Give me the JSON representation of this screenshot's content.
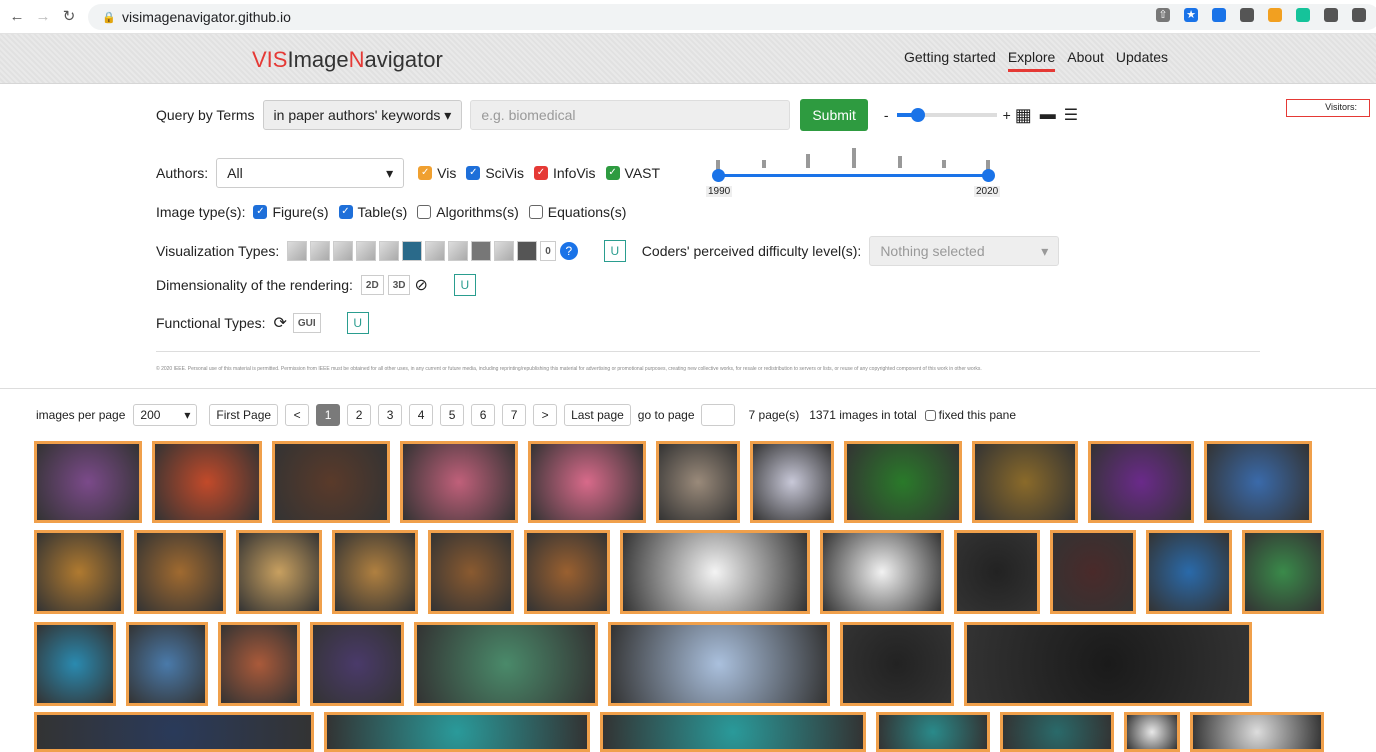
{
  "browser": {
    "url": "visimagenavigator.github.io"
  },
  "brand": {
    "p1": "VIS",
    "p2": "Image",
    "p3": "N",
    "p4": "avigator"
  },
  "nav": [
    "Getting started",
    "Explore",
    "About",
    "Updates"
  ],
  "query": {
    "label": "Query by Terms",
    "scope": "in paper authors' keywords",
    "placeholder": "e.g. biomedical",
    "submit": "Submit",
    "zoom_minus": "-",
    "zoom_plus": "+"
  },
  "visitors": "Visitors:",
  "authors": {
    "label": "Authors:",
    "value": "All"
  },
  "venues": [
    {
      "label": "Vis",
      "color": "#f0a030"
    },
    {
      "label": "SciVis",
      "color": "#1e6fd9"
    },
    {
      "label": "InfoVis",
      "color": "#e53935"
    },
    {
      "label": "VAST",
      "color": "#2e9b40"
    }
  ],
  "years": {
    "start": "1990",
    "end": "2020"
  },
  "image_types": {
    "label": "Image type(s):",
    "items": [
      {
        "label": "Figure(s)",
        "checked": true
      },
      {
        "label": "Table(s)",
        "checked": true
      },
      {
        "label": "Algorithms(s)",
        "checked": false
      },
      {
        "label": "Equations(s)",
        "checked": false
      }
    ]
  },
  "vis_types": {
    "label": "Visualization Types:",
    "zero": "0",
    "help": "?"
  },
  "u_label": "U",
  "difficulty": {
    "label": "Coders' perceived difficulty level(s):",
    "value": "Nothing selected"
  },
  "dimensionality": {
    "label": "Dimensionality of the rendering:",
    "d2": "2D",
    "d3": "3D"
  },
  "functional": {
    "label": "Functional Types:",
    "gui": "GUI"
  },
  "copyright": "© 2020 IEEE. Personal use of this material is permitted. Permission from IEEE must be obtained for all other uses, in any current or future media, including reprinting/republishing this material for advertising or promotional purposes, creating new collective works, for resale or redistribution to servers or lists, or reuse of any copyrighted component of this work in other works.",
  "pagination": {
    "per_page_label": "images per page",
    "per_page": "200",
    "first": "First Page",
    "prev": "<",
    "pages": [
      "1",
      "2",
      "3",
      "4",
      "5",
      "6",
      "7"
    ],
    "next": ">",
    "last": "Last page",
    "goto": "go to page",
    "summary": "7 page(s)   1371 images in total",
    "fixed": "fixed this pane"
  },
  "thumb_colors": [
    "#7b4a8a",
    "#c24a2a",
    "#5a3a2a",
    "#c0607a",
    "#d86a8a",
    "#9a8a7a",
    "#c8c8d8",
    "#2a7a2a",
    "#8a6a2a",
    "#6a2a8a",
    "#3a6aaa",
    "#b07a30",
    "#a06a30",
    "#c8a060",
    "#b08040",
    "#8a5a30",
    "#9a6030",
    "#f4f4f4",
    "#f2f2f2",
    "#222",
    "#4a2a2a",
    "#2a6aaa",
    "#3a8a4a",
    "#2a8ab0",
    "#4a7aaa",
    "#aa5a3a",
    "#4a3a6a",
    "#4a8a6a",
    "#aac0dd",
    "#222",
    "#1a1a1a",
    "#2a3a5a",
    "#2a9a9a",
    "#2a9a9a",
    "#2a8a8a",
    "#2a6a6a",
    "#e8e8e8",
    "#ddd"
  ]
}
